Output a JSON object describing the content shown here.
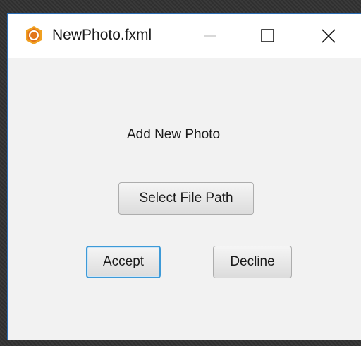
{
  "window": {
    "title": "NewPhoto.fxml",
    "minimize_icon": "minimize-icon",
    "maximize_icon": "maximize-icon",
    "close_icon": "close-icon",
    "app_icon": "javafx-app-icon",
    "accent_color": "#2a6cb4",
    "app_icon_color": "#f0a020"
  },
  "form": {
    "heading": "Add New Photo",
    "select_path_label": "Select File Path",
    "accept_label": "Accept",
    "decline_label": "Decline",
    "focus_color": "#3d9ad8"
  }
}
